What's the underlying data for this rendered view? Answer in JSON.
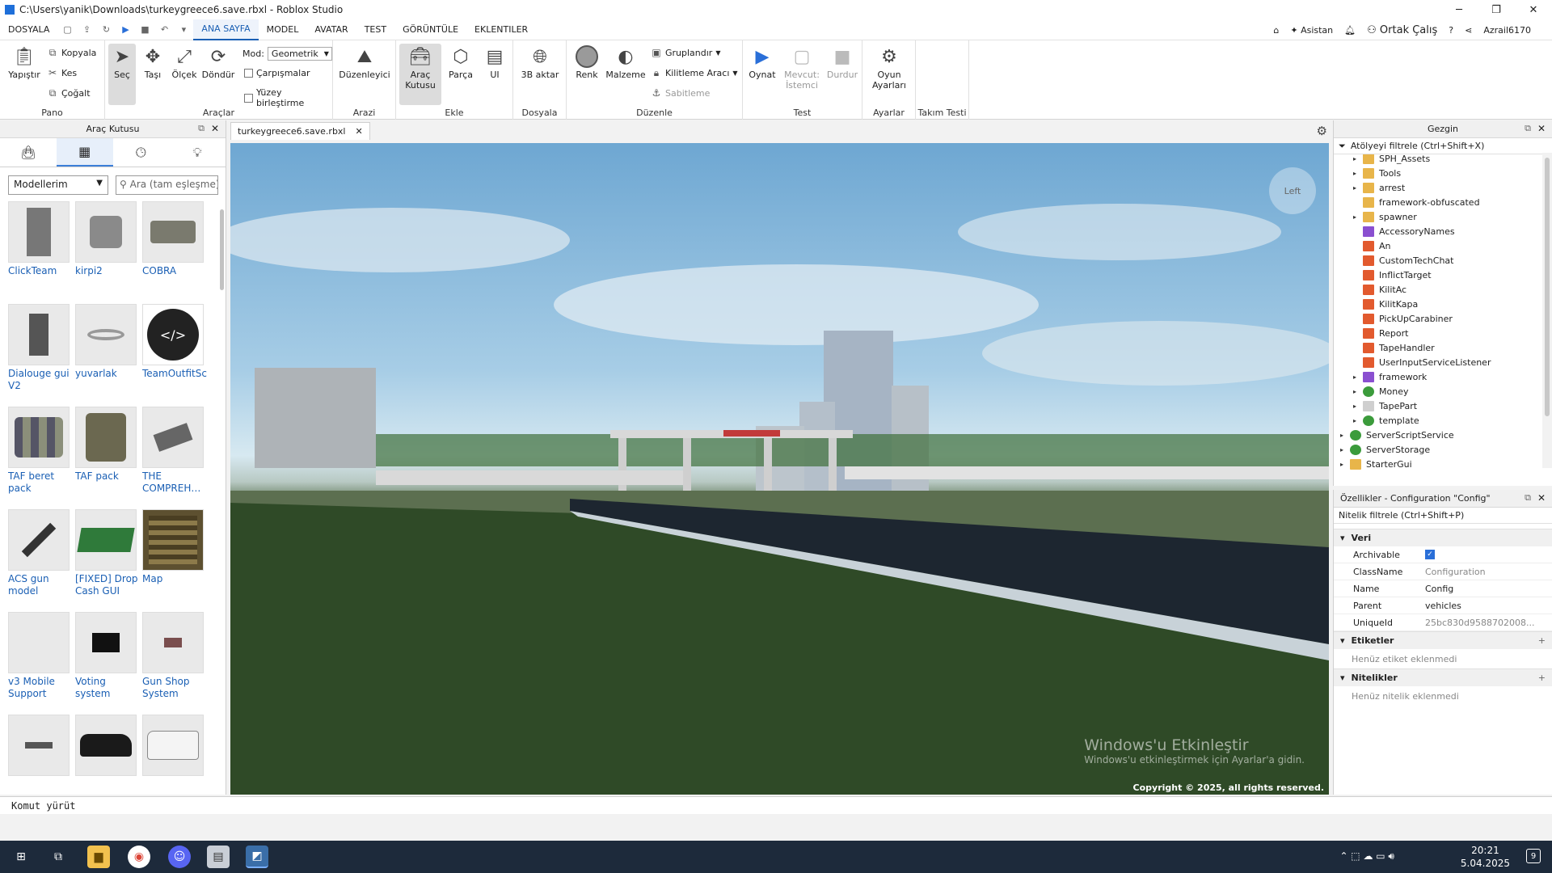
{
  "window": {
    "title": "C:\\Users\\yanik\\Downloads\\turkeygreece6.save.rbxl - Roblox Studio"
  },
  "menubar": {
    "file": "DOSYALA",
    "tabs": [
      "ANA SAYFA",
      "MODEL",
      "AVATAR",
      "TEST",
      "GÖRÜNTÜLE",
      "EKLENTILER"
    ],
    "assistant": "Asistan",
    "collab": "Ortak Çalış",
    "user": "Azrail6170"
  },
  "ribbon": {
    "pano": {
      "label": "Pano",
      "paste": "Yapıştır",
      "copy": "Kopyala",
      "cut": "Kes",
      "duplicate": "Çoğalt"
    },
    "araclar": {
      "label": "Araçlar",
      "select": "Seç",
      "move": "Taşı",
      "scale": "Ölçek",
      "rotate": "Döndür",
      "mode_label": "Mod:",
      "mode_value": "Geometrik",
      "collisions": "Çarpışmalar",
      "join_surfaces": "Yüzey birleştirme"
    },
    "arazi": {
      "label": "Arazi",
      "editor": "Düzenleyici"
    },
    "ekle": {
      "label": "Ekle",
      "toolbox_line1": "Araç",
      "toolbox_line2": "Kutusu",
      "part": "Parça",
      "ui": "UI"
    },
    "dosyala": {
      "label": "Dosyala",
      "import3d": "3B aktar"
    },
    "duzenle": {
      "label": "Düzenle",
      "color": "Renk",
      "material": "Malzeme",
      "group": "Gruplandır",
      "lock": "Kilitleme Aracı",
      "anchor": "Sabitleme"
    },
    "test": {
      "label": "Test",
      "play": "Oynat",
      "client_line1": "Mevcut:",
      "client_line2": "İstemci",
      "stop": "Durdur"
    },
    "ayarlar": {
      "label": "Ayarlar",
      "game_settings_line1": "Oyun",
      "game_settings_line2": "Ayarları"
    },
    "takim": {
      "label": "Takım Testi"
    }
  },
  "toolbox": {
    "title": "Araç Kutusu",
    "dropdown": "Modellerim",
    "search_placeholder": "Ara (tam eşleşme)",
    "items": [
      {
        "label": "ClickTeam"
      },
      {
        "label": "kirpi2"
      },
      {
        "label": "COBRA"
      },
      {
        "label": "Dialouge gui V2"
      },
      {
        "label": "yuvarlak"
      },
      {
        "label": "TeamOutfitScript"
      },
      {
        "label": "TAF beret pack"
      },
      {
        "label": "TAF pack"
      },
      {
        "label": "THE COMPREH…"
      },
      {
        "label": "ACS gun model"
      },
      {
        "label": "[FIXED] Drop Cash GUI"
      },
      {
        "label": "Map"
      },
      {
        "label": "v3 Mobile Support"
      },
      {
        "label": "Voting system"
      },
      {
        "label": "Gun Shop System"
      },
      {
        "label": ""
      },
      {
        "label": ""
      },
      {
        "label": ""
      }
    ]
  },
  "document": {
    "tab": "turkeygreece6.save.rbxl"
  },
  "viewport": {
    "view_cube": "Left",
    "copyright": "Copyright © 2025, all rights reserved.",
    "watermark": "Windows'u Etkinleştir",
    "watermark_sub": "Windows'u etkinleştirmek için Ayarlar'a gidin."
  },
  "explorer": {
    "title": "Gezgin",
    "filter": "Atölyeyi filtrele (Ctrl+Shift+X)",
    "nodes": [
      {
        "name": "SPH_Assets",
        "type": "folder",
        "arrow": "▸"
      },
      {
        "name": "Tools",
        "type": "folder",
        "arrow": "▸"
      },
      {
        "name": "arrest",
        "type": "folder",
        "arrow": "▸"
      },
      {
        "name": "framework-obfuscated",
        "type": "folder",
        "arrow": ""
      },
      {
        "name": "spawner",
        "type": "folder",
        "arrow": "▸"
      },
      {
        "name": "AccessoryNames",
        "type": "modscript",
        "arrow": ""
      },
      {
        "name": "An",
        "type": "script",
        "arrow": ""
      },
      {
        "name": "CustomTechChat",
        "type": "script",
        "arrow": ""
      },
      {
        "name": "InflictTarget",
        "type": "script",
        "arrow": ""
      },
      {
        "name": "KilitAc",
        "type": "script",
        "arrow": ""
      },
      {
        "name": "KilitKapa",
        "type": "script",
        "arrow": ""
      },
      {
        "name": "PickUpCarabiner",
        "type": "script",
        "arrow": ""
      },
      {
        "name": "Report",
        "type": "script",
        "arrow": ""
      },
      {
        "name": "TapeHandler",
        "type": "script",
        "arrow": ""
      },
      {
        "name": "UserInputServiceListener",
        "type": "script",
        "arrow": ""
      },
      {
        "name": "framework",
        "type": "modscript",
        "arrow": "▸"
      },
      {
        "name": "Money",
        "type": "svc",
        "arrow": "▸"
      },
      {
        "name": "TapePart",
        "type": "part",
        "arrow": "▸"
      },
      {
        "name": "template",
        "type": "svc",
        "arrow": "▸"
      },
      {
        "name": "ServerScriptService",
        "type": "svc",
        "arrow": "▸"
      },
      {
        "name": "ServerStorage",
        "type": "svc",
        "arrow": "▸"
      },
      {
        "name": "StarterGui",
        "type": "folder",
        "arrow": "▸"
      }
    ]
  },
  "properties": {
    "title": "Özellikler - Configuration \"Config\"",
    "filter": "Nitelik filtrele (Ctrl+Shift+P)",
    "section_data": "Veri",
    "rows": [
      {
        "name": "Archivable",
        "value": "✓"
      },
      {
        "name": "ClassName",
        "value": "Configuration"
      },
      {
        "name": "Name",
        "value": "Config"
      },
      {
        "name": "Parent",
        "value": "vehicles"
      },
      {
        "name": "UniqueId",
        "value": "25bc830d9588702008..."
      }
    ],
    "section_tags": "Etiketler",
    "tags_empty": "Henüz etiket eklenmedi",
    "section_attributes": "Nitelikler",
    "attributes_empty": "Henüz nitelik eklenmedi"
  },
  "command_bar": {
    "placeholder": "Komut yürüt"
  },
  "taskbar": {
    "time": "20:21",
    "date": "5.04.2025",
    "notifications": "9"
  }
}
